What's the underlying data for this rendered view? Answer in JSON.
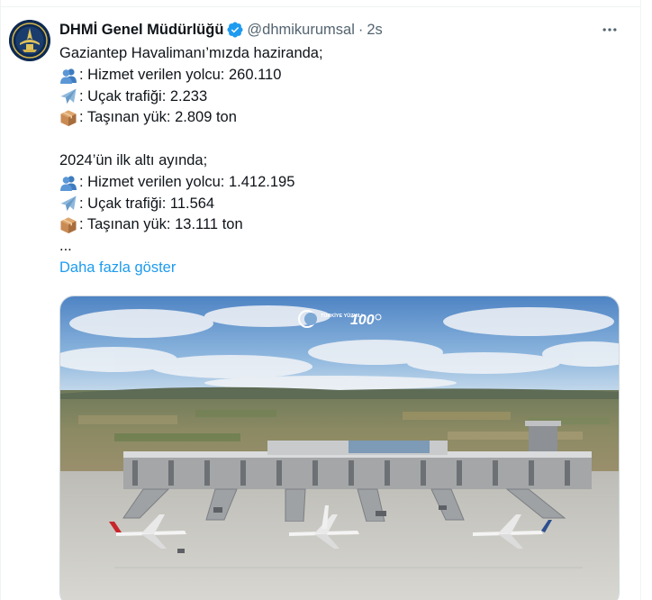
{
  "tweet": {
    "display_name": "DHMİ Genel Müdürlüğü",
    "handle": "@dhmikurumsal",
    "separator": "·",
    "timestamp": "2s",
    "verified": true,
    "body": {
      "line1": "Gaziantep Havalimanı’mızda haziranda;",
      "june_passengers": ": Hizmet verilen yolcu: 260.110",
      "june_flights": ": Uçak trafiği: 2.233",
      "june_cargo": ": Taşınan yük: 2.809 ton",
      "line5": "2024’ün ilk altı ayında;",
      "h1_passengers": ": Hizmet verilen yolcu: 1.412.195",
      "h1_flights": ": Uçak trafiği: 11.564",
      "h1_cargo": ": Taşınan yük: 13.111 ton",
      "ellipsis": "..."
    },
    "show_more": "Daha fazla göster",
    "media": {
      "overlay_logo_text": "TÜRKİYE YÜZYILI",
      "overlay_number": "100"
    }
  },
  "icons": {
    "passengers": "busts-in-silhouette-icon",
    "flights": "airplane-icon",
    "cargo": "package-icon",
    "verified": "verified-badge-icon",
    "more": "more-horizontal-icon"
  },
  "colors": {
    "link": "#1d9bf0",
    "secondary_text": "#536471",
    "primary_text": "#0f1419",
    "verified": "#1d9bf0"
  }
}
